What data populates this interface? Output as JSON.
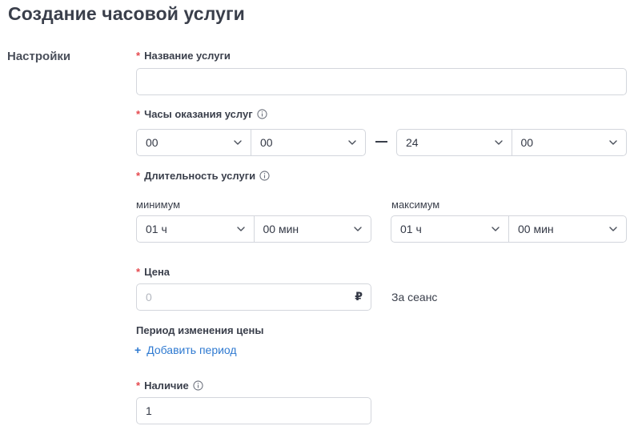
{
  "header": {
    "title": "Создание часовой услуги"
  },
  "section": {
    "label": "Настройки"
  },
  "service_name": {
    "label": "Название услуги",
    "value": "",
    "placeholder": ""
  },
  "hours": {
    "label": "Часы оказания услуг",
    "from_hours": "00",
    "from_minutes": "00",
    "separator": "—",
    "to_hours": "24",
    "to_minutes": "00"
  },
  "duration": {
    "label": "Длительность услуги",
    "min_label": "минимум",
    "min_hours": "01 ч",
    "min_minutes": "00 мин",
    "max_label": "максимум",
    "max_hours": "01 ч",
    "max_minutes": "00 мин"
  },
  "price": {
    "label": "Цена",
    "value": "",
    "placeholder": "0",
    "currency": "₽",
    "per": "За сеанс"
  },
  "price_period": {
    "label": "Период изменения цены",
    "add_plus": "+",
    "add_label": "Добавить период"
  },
  "availability": {
    "label": "Наличие",
    "value": "1"
  },
  "required_mark": "*",
  "colors": {
    "accent": "#2f7ad1",
    "required": "#e5484d",
    "border": "#d3d6dc",
    "text": "#3a3f4b"
  }
}
